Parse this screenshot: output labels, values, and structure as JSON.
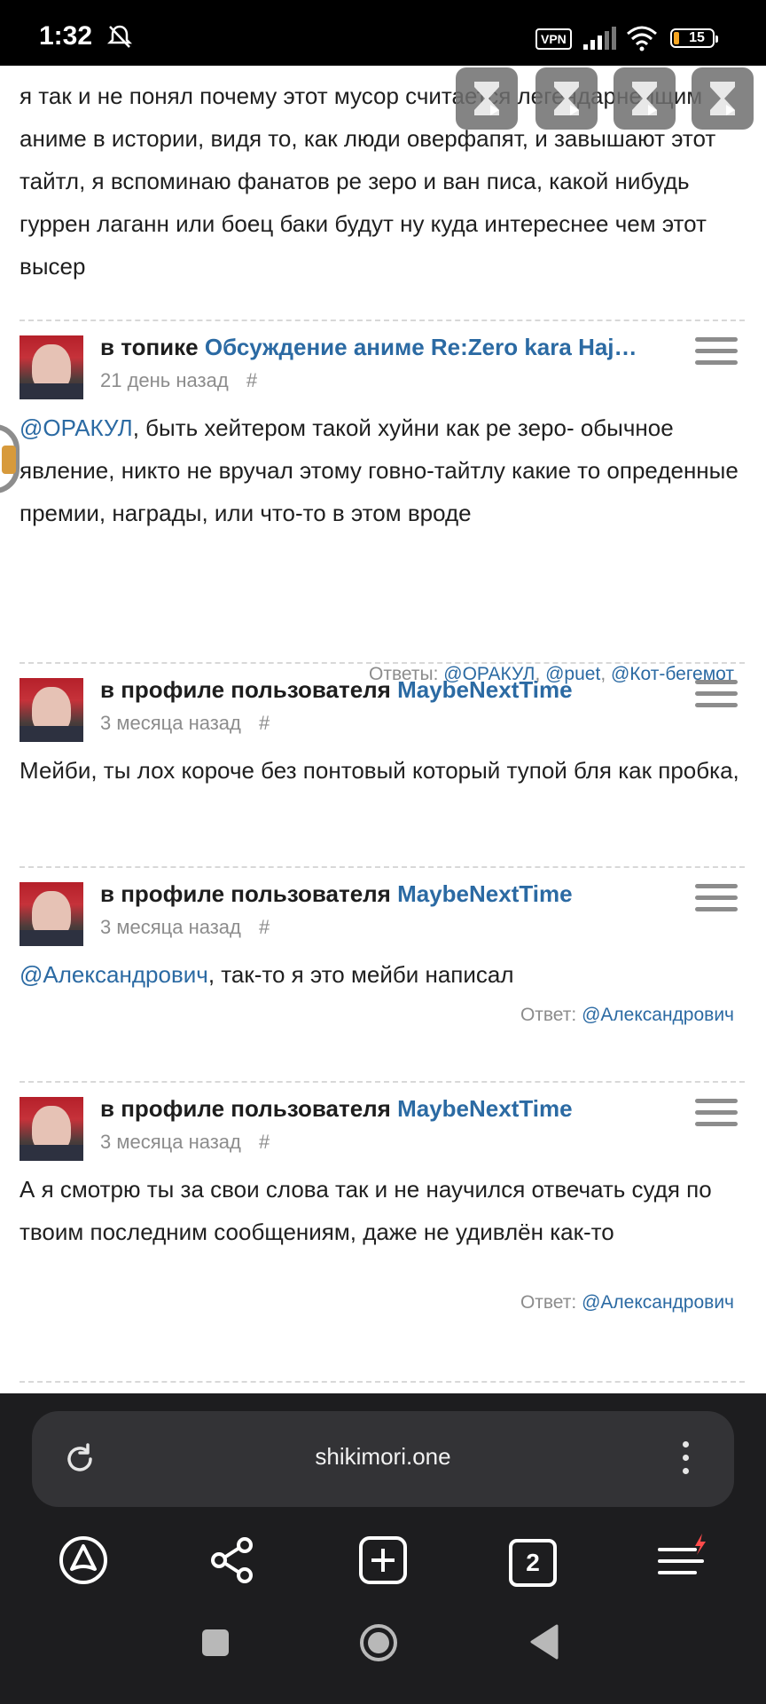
{
  "status_bar": {
    "time": "1:32",
    "vpn_label": "VPN",
    "battery": "15",
    "battery_color": "#f5a623"
  },
  "colors": {
    "link": "#2b6aa3",
    "muted": "#8c8c8c",
    "browser_bg": "#1d1d1f"
  },
  "top_comment": {
    "text": "я так и не понял почему этот мусор считается легендарнейщим аниме в истории, видя то, как люди оверфапят, и завышают этот тайтл, я вспоминаю фанатов ре зеро и ван писа, какой нибудь гуррен лаганн или боец баки будут ну куда интереснее чем этот высер"
  },
  "comments": [
    {
      "prefix": "в топике",
      "target": "Обсуждение аниме Re:Zero kara Haj…",
      "time": "21 день назад",
      "hash": "#",
      "mention": "@ОРАКУЛ",
      "text": ", быть хейтером такой хуйни как ре зеро- обычное явление, никто не вручал этому говно-тайтлу какие то опреденные премии, награды, или что-то в этом вроде",
      "replies_label": "Ответы: ",
      "replies": [
        "@ОРАКУЛ",
        "@puet",
        "@Кот-бегемот"
      ]
    },
    {
      "prefix": "в профиле пользователя",
      "target": "MaybeNextTime",
      "time": "3 месяца назад",
      "hash": "#",
      "text": "Мейби, ты лох короче без понтовый который тупой бля как пробка,"
    },
    {
      "prefix": "в профиле пользователя",
      "target": "MaybeNextTime",
      "time": "3 месяца назад",
      "hash": "#",
      "mention": "@Александрович",
      "text": ", так-то я это мейби написал",
      "replies_label": "Ответ: ",
      "replies": [
        "@Александрович"
      ]
    },
    {
      "prefix": "в профиле пользователя",
      "target": "MaybeNextTime",
      "time": "3 месяца назад",
      "hash": "#",
      "text": "А я смотрю ты за свои слова так и не научился отвечать судя по твоим последним сообщениям, даже не удивлён как-то",
      "replies_label": "Ответ: ",
      "replies": [
        "@Александрович"
      ]
    }
  ],
  "browser": {
    "url": "shikimori.one",
    "tab_count": "2"
  }
}
